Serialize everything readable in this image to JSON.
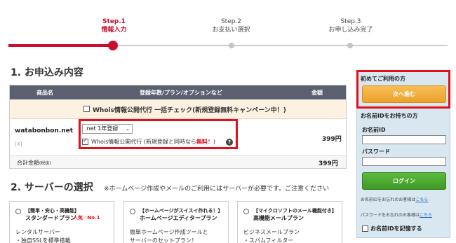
{
  "stepper": {
    "steps": [
      {
        "num": "Step.1",
        "label": "情報入力",
        "active": true
      },
      {
        "num": "Step.2",
        "label": "お支払い選択",
        "active": false
      },
      {
        "num": "Step.3",
        "label": "お申し込み完了",
        "active": false
      }
    ]
  },
  "order": {
    "section_title": "1. お申込み内容",
    "headers": [
      "商品名",
      "登録年数/プラン/オプションなど",
      "金額"
    ],
    "bulk_check_label": "Whois情報公開代行 一括チェック(新規登録無料キャンペーン中！)",
    "domain": "watabonbon.net",
    "remove_label": "[X]",
    "select_value": ".net 1年登録",
    "whois_label_before": "Whois情報公開代行 (新規登録と同時なら",
    "whois_free": "無料",
    "whois_label_after": "！)",
    "help_icon": "?",
    "price": "399円",
    "total_label": "合計金額",
    "total_tax": "(税抜)",
    "total_price": "399円"
  },
  "server": {
    "section_title": "2. サーバーの選択",
    "note": "※ホームページ作成やメールのご利用にはサーバーが必要です。ご注意ください",
    "plans": [
      {
        "tag": "【簡単・安心・高機能】",
        "name": "スタンダードプラン",
        "popular": "人気☆No.1",
        "desc1": "レンタルサーバー",
        "desc2": "・独自SSLを標準搭載"
      },
      {
        "tag": "【ホームページがスイスイ作れる！】",
        "name": "ホームページエディタープラン",
        "popular": "",
        "desc1": "簡単ホームページ作成ツールと",
        "desc2": "サーバーのセットプラン！"
      },
      {
        "tag": "【マイクロソフトのメール機能付き】",
        "name": "高機能メールプラン",
        "popular": "",
        "desc1": "ビジネスメールプラン",
        "desc2": "・スパムフィルター"
      }
    ]
  },
  "login": {
    "first_title": "初めてご利用の方",
    "next_button": "次へ進む",
    "member_title": "お名前IDをお持ちの方",
    "id_label": "お名前ID",
    "pw_label": "パスワード",
    "login_button": "ログイン",
    "forgot_id_text": "お名前IDをお忘れのお客様は",
    "forgot_pw_text": "パスワードをお忘れのお客様は",
    "here_link": "こちら",
    "remember_label": "お名前IDを記憶する"
  },
  "colors": {
    "accent_red": "#c8102e",
    "highlight_red": "#e0101c",
    "next_button": "#f0a93c",
    "login_button": "#4aa82f",
    "panel_bg": "#d8e7f0",
    "table_header": "#5a6070"
  }
}
